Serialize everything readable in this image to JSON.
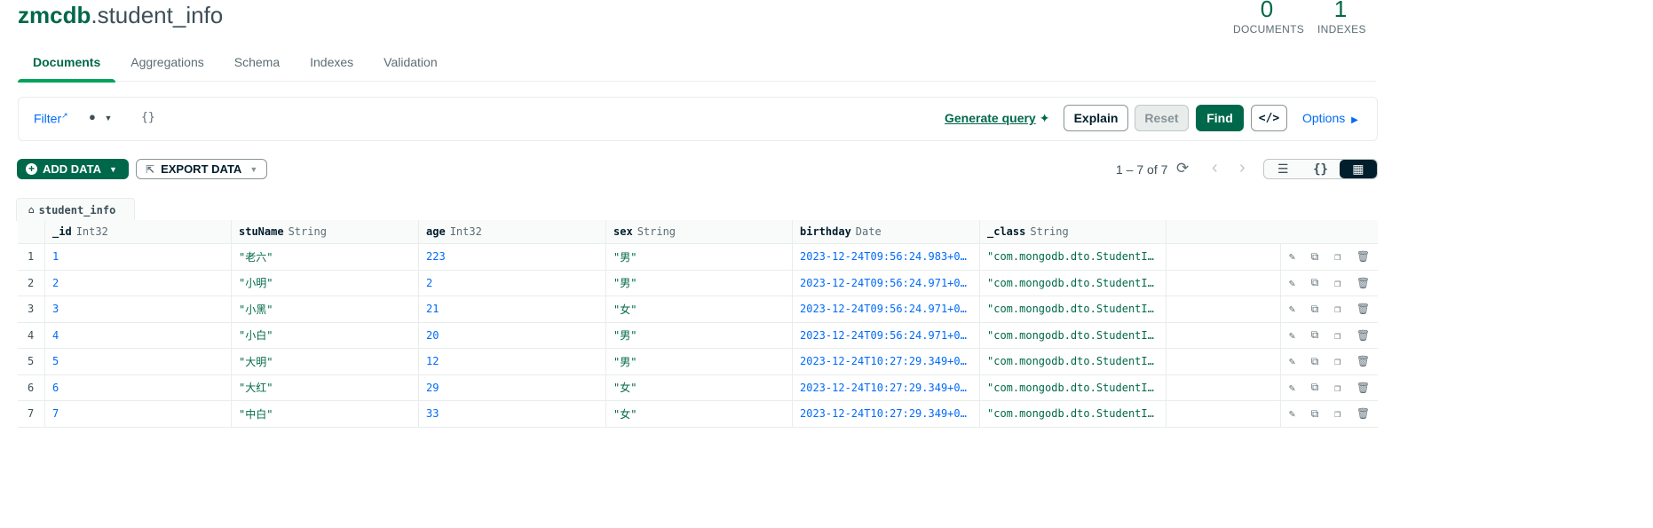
{
  "header": {
    "db": "zmcdb",
    "collection": ".student_info",
    "documents_count": "0",
    "documents_label": "DOCUMENTS",
    "indexes_count": "1",
    "indexes_label": "INDEXES"
  },
  "tabs": [
    {
      "label": "Documents",
      "active": true
    },
    {
      "label": "Aggregations"
    },
    {
      "label": "Schema"
    },
    {
      "label": "Indexes"
    },
    {
      "label": "Validation"
    }
  ],
  "querybar": {
    "filter_label": "Filter",
    "filter_value": "{}",
    "generate_query": "Generate query",
    "explain": "Explain",
    "reset": "Reset",
    "find": "Find",
    "code": "</>",
    "options": "Options"
  },
  "toolbar": {
    "add_data": "ADD DATA",
    "export_data": "EXPORT DATA",
    "pager": "1 – 7 of 7"
  },
  "breadcrumb": "student_info",
  "columns": [
    {
      "name": "_id",
      "type": "Int32"
    },
    {
      "name": "stuName",
      "type": "String"
    },
    {
      "name": "age",
      "type": "Int32"
    },
    {
      "name": "sex",
      "type": "String"
    },
    {
      "name": "birthday",
      "type": "Date"
    },
    {
      "name": "_class",
      "type": "String"
    }
  ],
  "rows": [
    {
      "n": "1",
      "id": "1",
      "stuName": "\"老六\"",
      "age": "223",
      "sex": "\"男\"",
      "birthday": "2023-12-24T09:56:24.983+0…",
      "cls": "\"com.mongodb.dto.StudentI…"
    },
    {
      "n": "2",
      "id": "2",
      "stuName": "\"小明\"",
      "age": "2",
      "sex": "\"男\"",
      "birthday": "2023-12-24T09:56:24.971+0…",
      "cls": "\"com.mongodb.dto.StudentI…"
    },
    {
      "n": "3",
      "id": "3",
      "stuName": "\"小黑\"",
      "age": "21",
      "sex": "\"女\"",
      "birthday": "2023-12-24T09:56:24.971+0…",
      "cls": "\"com.mongodb.dto.StudentI…"
    },
    {
      "n": "4",
      "id": "4",
      "stuName": "\"小白\"",
      "age": "20",
      "sex": "\"男\"",
      "birthday": "2023-12-24T09:56:24.971+0…",
      "cls": "\"com.mongodb.dto.StudentI…"
    },
    {
      "n": "5",
      "id": "5",
      "stuName": "\"大明\"",
      "age": "12",
      "sex": "\"男\"",
      "birthday": "2023-12-24T10:27:29.349+0…",
      "cls": "\"com.mongodb.dto.StudentI…"
    },
    {
      "n": "6",
      "id": "6",
      "stuName": "\"大红\"",
      "age": "29",
      "sex": "\"女\"",
      "birthday": "2023-12-24T10:27:29.349+0…",
      "cls": "\"com.mongodb.dto.StudentI…"
    },
    {
      "n": "7",
      "id": "7",
      "stuName": "\"中白\"",
      "age": "33",
      "sex": "\"女\"",
      "birthday": "2023-12-24T10:27:29.349+0…",
      "cls": "\"com.mongodb.dto.StudentI…"
    }
  ],
  "icons": {
    "edit": "pencil-icon",
    "copy": "copy-icon",
    "clone": "clone-icon",
    "delete": "trash-icon"
  },
  "colors": {
    "brand_green": "#00684a",
    "link_blue": "#016bf8"
  }
}
